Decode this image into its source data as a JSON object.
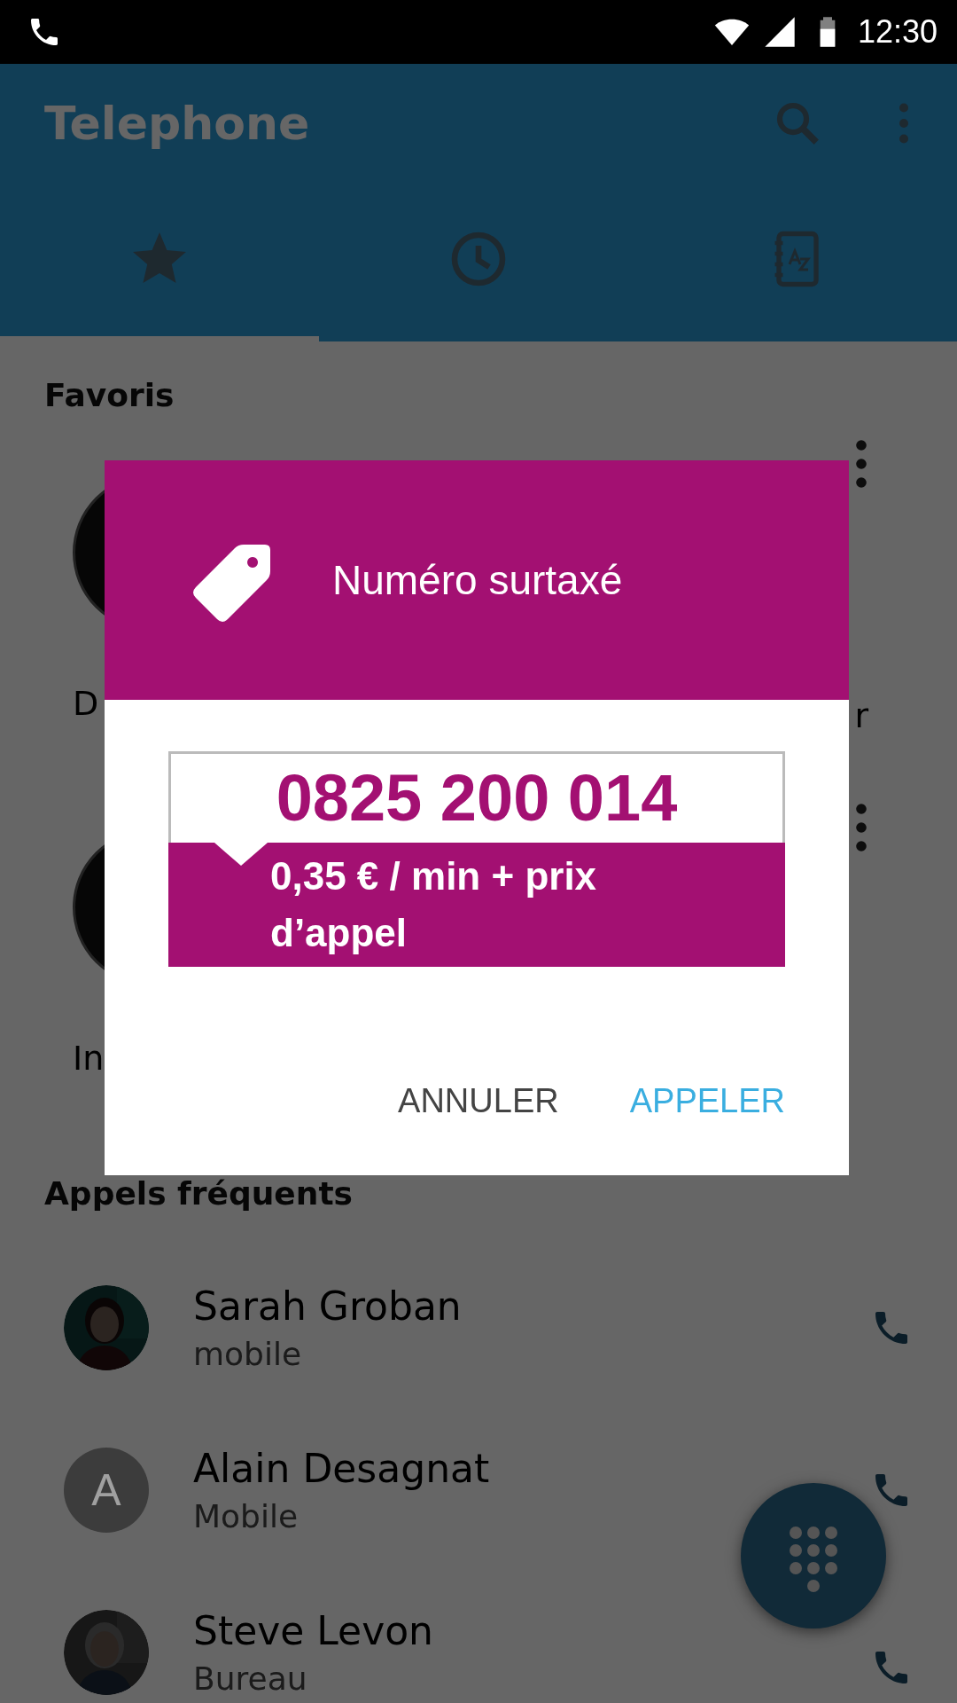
{
  "status_bar": {
    "time": "12:30"
  },
  "app_bar": {
    "title": "Telephone"
  },
  "tabs": [
    {
      "kind": "favorites",
      "selected": true
    },
    {
      "kind": "recent",
      "selected": false
    },
    {
      "kind": "contacts",
      "selected": false
    }
  ],
  "favorites": {
    "title": "Favoris",
    "rows": [
      {
        "left_label": "D",
        "right_label": "r"
      },
      {
        "left_label": "In"
      }
    ]
  },
  "frequent": {
    "title": "Appels fréquents",
    "contacts": [
      {
        "name": "Sarah Groban",
        "type": "mobile"
      },
      {
        "name": "Alain Desagnat",
        "type": "Mobile",
        "kind": "letter",
        "initial": "A"
      },
      {
        "name": "Steve Levon",
        "type": "Bureau"
      }
    ]
  },
  "dialog": {
    "title": "Numéro surtaxé",
    "number": "0825 200 014",
    "price": "0,35 € / min + prix d’appel",
    "buttons": [
      {
        "label": "ANNULER",
        "kind": "cancel"
      },
      {
        "label": "APPELER",
        "kind": "confirm"
      }
    ]
  }
}
